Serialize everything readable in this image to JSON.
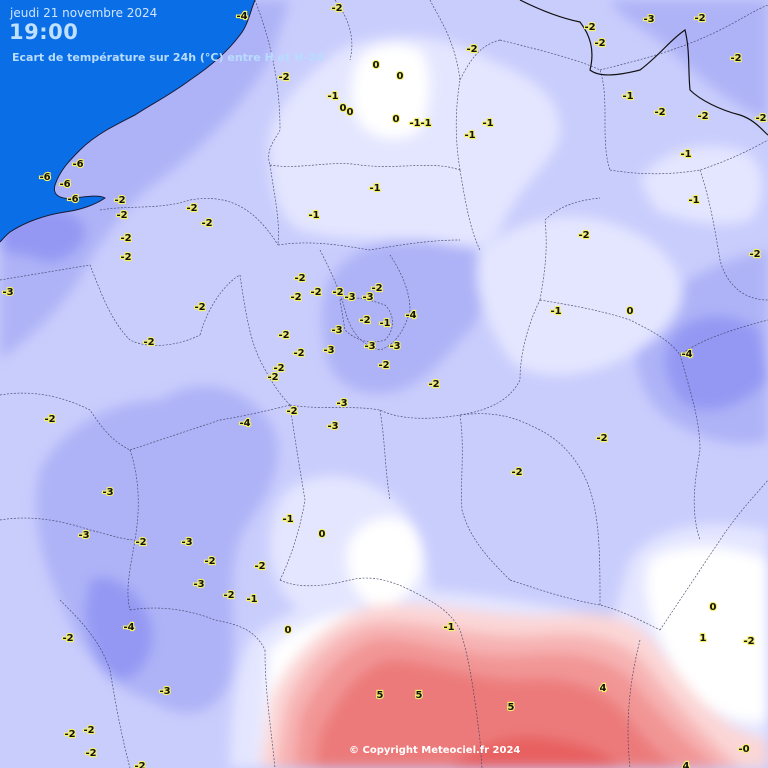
{
  "header": {
    "date": "jeudi 21 novembre 2024",
    "time": "19:00",
    "subtitle": "Ecart de température sur 24h (°C) entre H et H-24"
  },
  "copyright": "© Copyright Meteociel.fr 2024",
  "colors": {
    "sea": "#0a6fe6",
    "minus1": "#e4e6ff",
    "minus2": "#c9cdfc",
    "minus3": "#aeb3f7",
    "minus4": "#9498f3",
    "zero": "#ffffff",
    "plus2": "#fbd6d6",
    "plus3": "#f7b3b3",
    "plus4": "#f29595",
    "plus5": "#ec7a7a",
    "plus6": "#e86060",
    "label_text": "#111111",
    "label_halo": "#f4f06a"
  },
  "station_values": [
    "-4",
    "-2",
    "-2",
    "-2",
    "-3",
    "-2",
    "-2",
    "-2",
    "-2",
    "-1",
    "0",
    "0",
    "0",
    "0",
    "-1",
    "-1",
    "0",
    "-1",
    "-1",
    "-1",
    "-2",
    "-2",
    "-2",
    "-1",
    "-1",
    "-2",
    "-1",
    "-6",
    "-6",
    "-6",
    "-6",
    "-2",
    "-2",
    "-2",
    "-2",
    "-1",
    "-2",
    "-2",
    "-2",
    "-1",
    "-2",
    "-2",
    "-2",
    "-2",
    "-2",
    "-3",
    "-2",
    "-3",
    "-3",
    "-4",
    "-3",
    "-3",
    "-1",
    "0",
    "-2",
    "-2",
    "-2",
    "-3",
    "-2",
    "-3",
    "-4",
    "-2",
    "-2",
    "-2",
    "-4",
    "-2",
    "-2",
    "-3",
    "-2",
    "-3",
    "-2",
    "-1",
    "0",
    "-3",
    "-2",
    "-3",
    "-2",
    "-3",
    "-2",
    "-2",
    "-3",
    "-1",
    "-2",
    "0",
    "-4",
    "-2",
    "-1",
    "5",
    "5",
    "5",
    "4",
    "0",
    "1",
    "-2",
    "-3",
    "-2",
    "-2",
    "-2",
    "-0",
    "-2",
    "4"
  ]
}
